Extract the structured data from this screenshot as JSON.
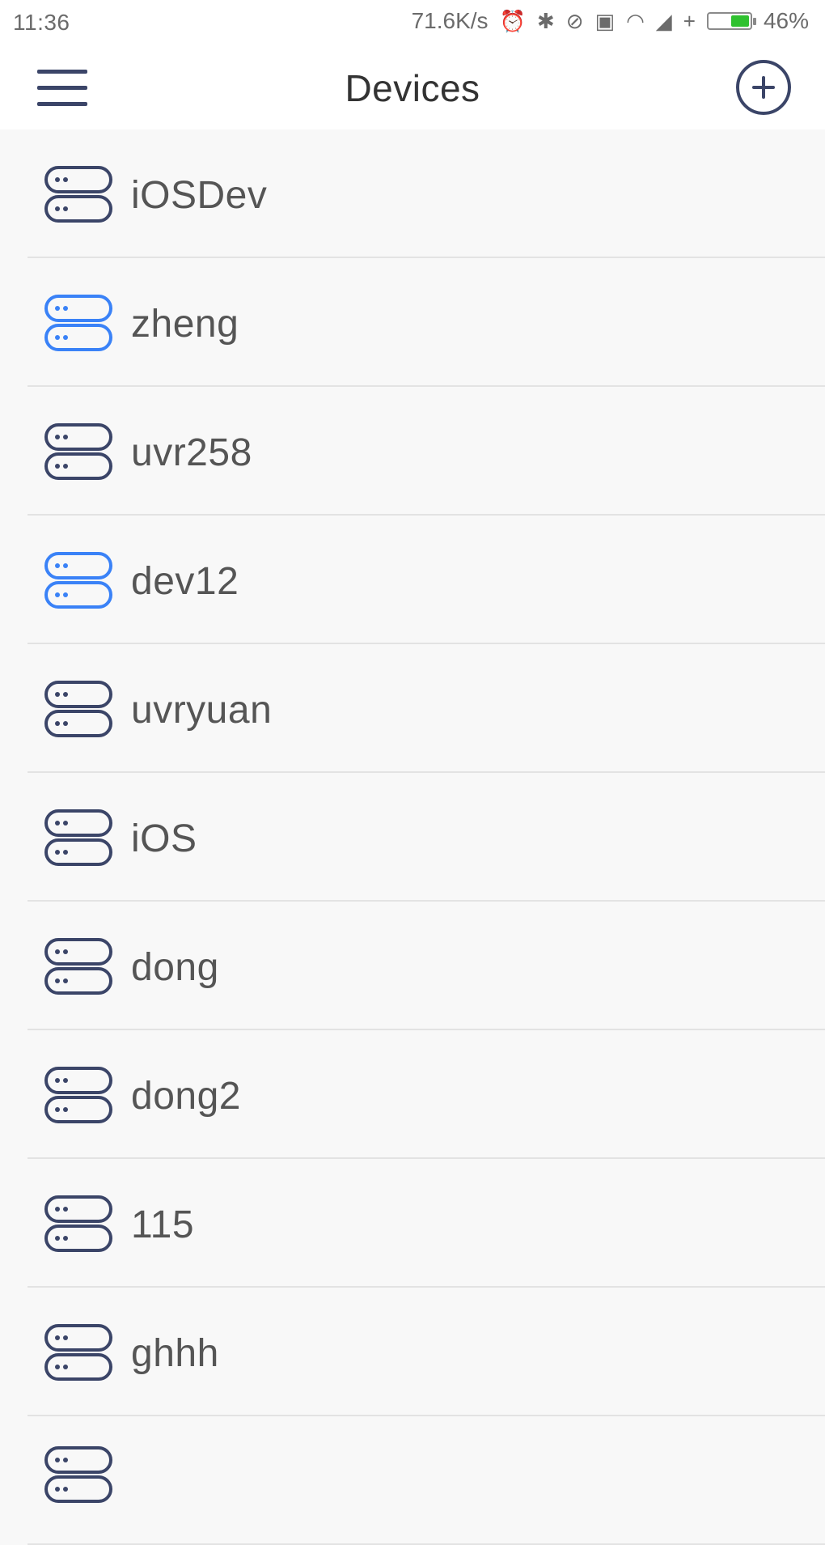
{
  "status_bar": {
    "time": "11:36",
    "speed": "71.6K/s",
    "battery_percent": "46%",
    "battery_level": 0.46,
    "icons": [
      "alarm-icon",
      "bluetooth-icon",
      "blocked-icon",
      "sim-icon",
      "wifi-icon",
      "signal-icon",
      "charging-icon",
      "battery-icon"
    ]
  },
  "app_bar": {
    "title": "Devices",
    "menu_icon": "hamburger-menu-icon",
    "add_icon": "plus-circle-icon"
  },
  "colors": {
    "icon_default": "#3b4568",
    "icon_active": "#3a82f7",
    "text_primary": "#555555",
    "background": "#f8f8f8",
    "divider": "#e3e3e3"
  },
  "devices": [
    {
      "name": "iOSDev",
      "active": false
    },
    {
      "name": "zheng",
      "active": true
    },
    {
      "name": "uvr258",
      "active": false
    },
    {
      "name": "dev12",
      "active": true
    },
    {
      "name": "uvryuan",
      "active": false
    },
    {
      "name": "iOS",
      "active": false
    },
    {
      "name": "dong",
      "active": false
    },
    {
      "name": "dong2",
      "active": false
    },
    {
      "name": "115",
      "active": false
    },
    {
      "name": "ghhh",
      "active": false
    },
    {
      "name": "",
      "active": false
    }
  ]
}
